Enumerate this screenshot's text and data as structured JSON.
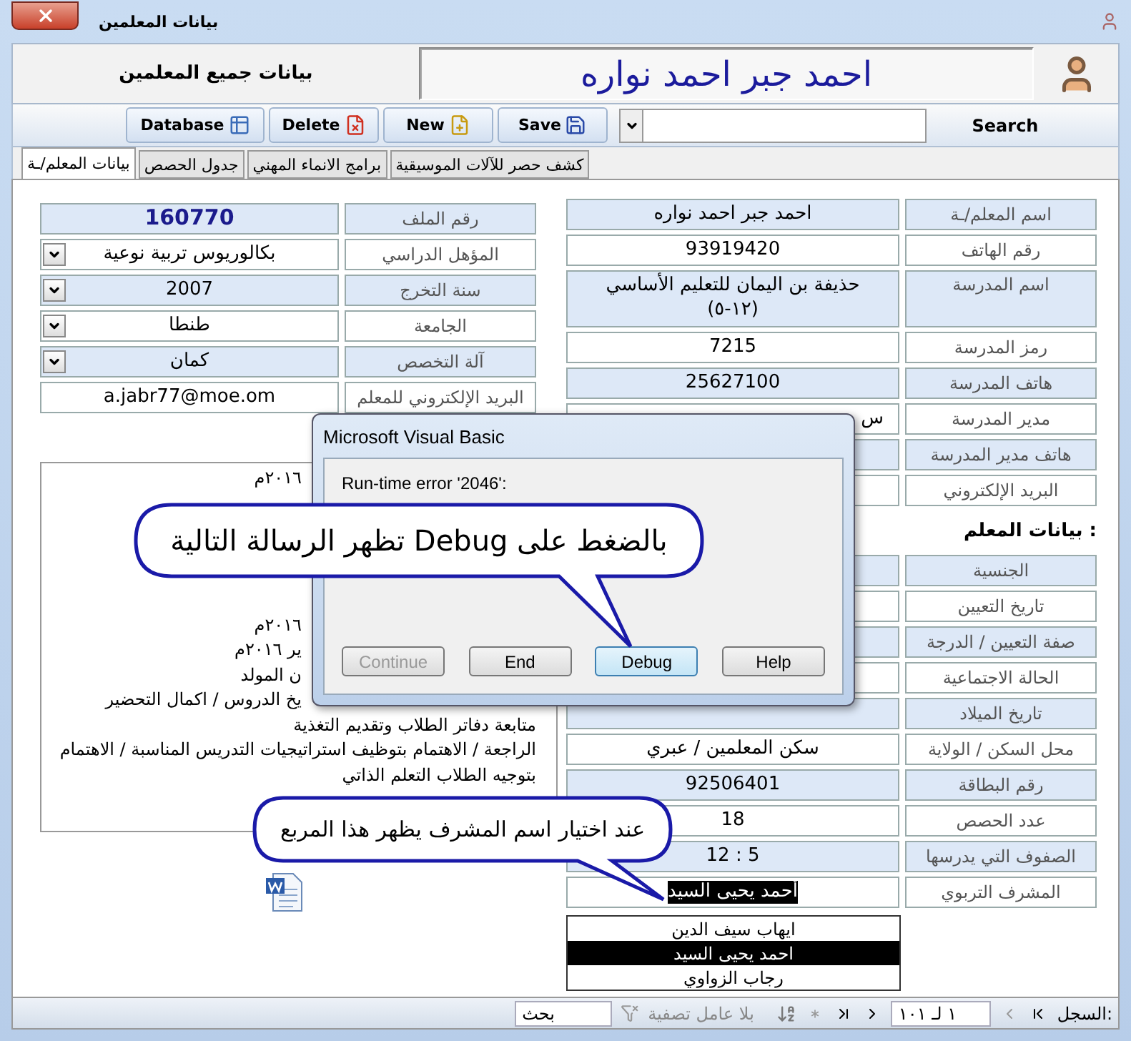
{
  "window": {
    "title": "بيانات المعلمين"
  },
  "header": {
    "title": "بيانات جميع المعلمين",
    "teacher_name": "احمد جبر احمد نواره"
  },
  "toolbar": {
    "search_label": "Search",
    "buttons": [
      {
        "label": "Save",
        "kind": "save"
      },
      {
        "label": "New",
        "kind": "new"
      },
      {
        "label": "Delete",
        "kind": "delete"
      },
      {
        "label": "Database",
        "kind": "database"
      }
    ]
  },
  "tabs": [
    {
      "label": "كشف حصر للآلات الموسيقية",
      "selected": false
    },
    {
      "label": "برامج الانماء المهني",
      "selected": false
    },
    {
      "label": "جدول الحصص",
      "selected": false
    },
    {
      "label": "بيانات المعلم/ـة",
      "selected": true
    }
  ],
  "right_fields": [
    {
      "label": "اسم المعلم/ـة",
      "value": "احمد جبر احمد نواره"
    },
    {
      "label": "رقم الهاتف",
      "value": "93919420"
    },
    {
      "label": "اسم المدرسة",
      "value": "حذيفة بن اليمان للتعليم الأساسي (١٢-٥)",
      "kind": "tall"
    },
    {
      "label": "رمز المدرسة",
      "value": "7215"
    },
    {
      "label": "هاتف المدرسة",
      "value": "25627100"
    },
    {
      "label": "مدير المدرسة",
      "value": "س",
      "kind": "edge"
    },
    {
      "label": "هاتف مدير المدرسة"
    },
    {
      "label": "البريد الإلكتروني"
    }
  ],
  "left_fields": [
    {
      "label": "رقم الملف",
      "value": "160770",
      "kind": "id"
    },
    {
      "label": "المؤهل الدراسي",
      "value": "بكالوريوس تربية نوعية",
      "kind": "combo"
    },
    {
      "label": "سنة التخرج",
      "value": "2007",
      "kind": "combo"
    },
    {
      "label": "الجامعة",
      "value": "طنطا",
      "kind": "combo"
    },
    {
      "label": "آلة التخصص",
      "value": "كمان",
      "kind": "combo"
    },
    {
      "label": "البريد الإلكتروني للمعلم",
      "value": "a.jabr77@moe.om",
      "kind": "email"
    }
  ],
  "notes": {
    "upper": [
      "٢٠١٦م"
    ],
    "middle": [
      "٢٠١٦م",
      "ير ٢٠١٦م",
      "ن المولد",
      "يخ الدروس / اكمال التحضير"
    ],
    "lower": [
      "متابعة دفاتر الطلاب وتقديم التغذية",
      "الراجعة / الاهتمام بتوظيف استراتيجيات التدريس المناسبة / الاهتمام",
      "بتوجيه الطلاب التعلم الذاتي"
    ]
  },
  "teacher_heading": "بيانات المعلم :",
  "teacher_fields": [
    {
      "label": "الجنسية"
    },
    {
      "label": "تاريخ التعيين"
    },
    {
      "label": "صفة التعيين / الدرجة"
    },
    {
      "label": "الحالة الاجتماعية"
    },
    {
      "label": "تاريخ الميلاد"
    },
    {
      "label": "محل السكن / الولاية",
      "value": "سكن المعلمين / عبري"
    },
    {
      "label": "رقم البطاقة",
      "value": "92506401"
    },
    {
      "label": "عدد الحصص",
      "value": "18"
    },
    {
      "label": "الصفوف التي يدرسها",
      "value": "5 :  12"
    },
    {
      "label": "المشرف التربوي",
      "value": "أحمد يحيى السيد",
      "kind": "select"
    }
  ],
  "supervisor_options": [
    {
      "label": "ايهاب سيف الدين",
      "selected": false
    },
    {
      "label": "احمد يحيى السيد",
      "selected": true
    },
    {
      "label": "رجاب الزواوي",
      "selected": false
    }
  ],
  "dialog": {
    "title": "Microsoft Visual Basic",
    "message": "Run-time error '2046':",
    "buttons": [
      {
        "label": "Help",
        "disabled": false,
        "focused": false
      },
      {
        "label": "Debug",
        "disabled": false,
        "focused": true
      },
      {
        "label": "End",
        "disabled": false,
        "focused": false
      },
      {
        "label": "Continue",
        "disabled": true,
        "focused": false
      }
    ]
  },
  "callouts": [
    {
      "text": "بالضغط على Debug تظهر الرسالة التالية",
      "kind": "debug"
    },
    {
      "text": "عند اختيار اسم المشرف يظهر هذا المربع",
      "kind": "list"
    }
  ],
  "status_bar": {
    "record_label": "السجل:",
    "record": "١ لـ ١٠١",
    "filter": "بلا عامل تصفية",
    "search": "بحث"
  }
}
